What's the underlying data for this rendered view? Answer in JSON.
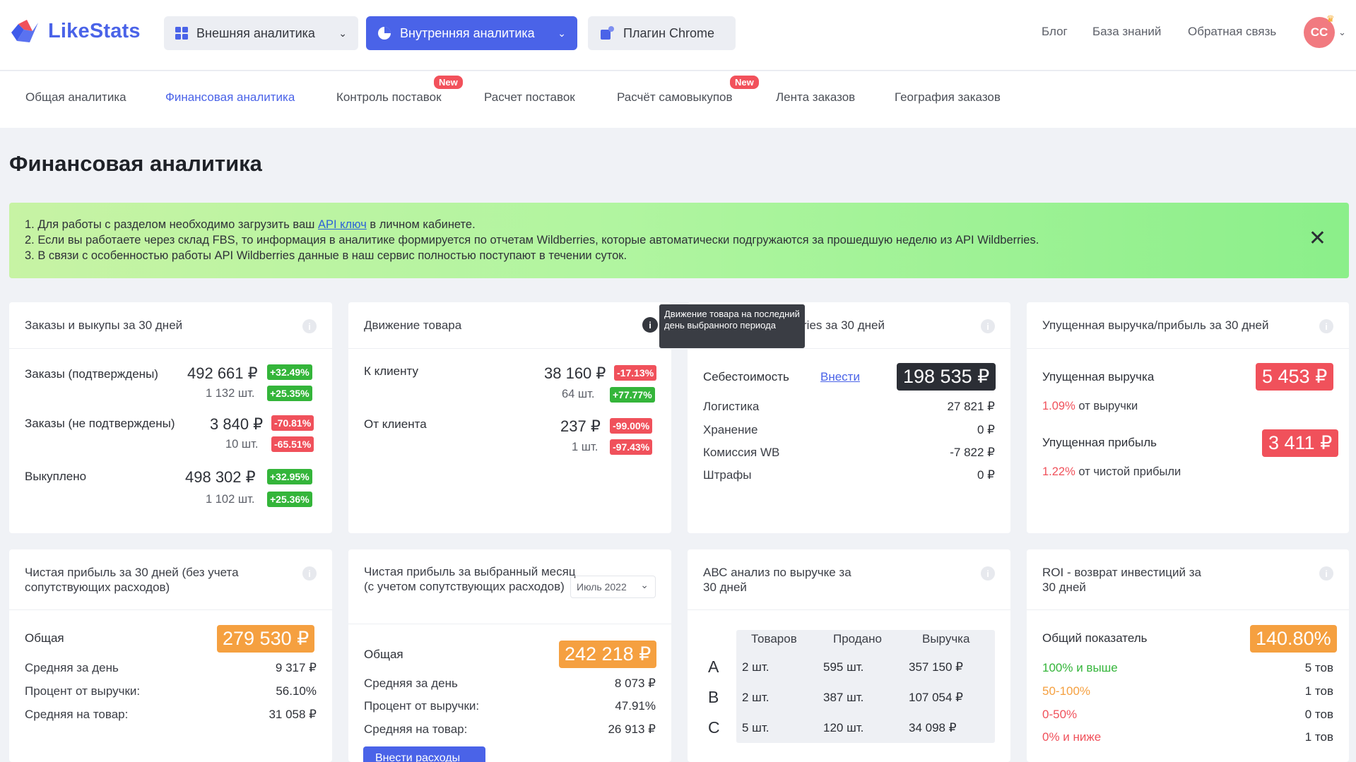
{
  "header": {
    "logo_text": "LikeStats",
    "nav_external": "Внешняя аналитика",
    "nav_internal": "Внутренняя аналитика",
    "nav_plugin": "Плагин Chrome",
    "links": [
      "Блог",
      "База знаний",
      "Обратная связь"
    ],
    "avatar_initials": "CC"
  },
  "tabs": [
    {
      "label": "Общая аналитика"
    },
    {
      "label": "Финансовая аналитика",
      "active": true
    },
    {
      "label": "Контроль поставок",
      "badge": "New"
    },
    {
      "label": "Расчет поставок"
    },
    {
      "label": "Расчёт самовыкупов",
      "badge": "New"
    },
    {
      "label": "Лента заказов"
    },
    {
      "label": "География заказов"
    }
  ],
  "page_title": "Финансовая аналитика",
  "banner": {
    "line1_before": "1. Для работы с разделом необходимо загрузить ваш ",
    "line1_link": "API ключ",
    "line1_after": " в личном кабинете.",
    "line2": "2. Если вы работаете через склад FBS, то информация в аналитике формируется по отчетам Wildberries, которые автоматически подгружаются за прошедшую неделю из API Wildberries.",
    "line3": "3. В связи с особенностью работы API Wildberries данные в наш сервис полностью поступают в течении суток."
  },
  "orders_card": {
    "title": "Заказы и выкупы за 30 дней",
    "confirmed_label": "Заказы (подтверждены)",
    "confirmed_amount": "492 661 ₽",
    "confirmed_amount_change": "+32.49%",
    "confirmed_qty": "1 132 шт.",
    "confirmed_qty_change": "+25.35%",
    "unconfirmed_label": "Заказы (не подтверждены)",
    "unconfirmed_amount": "3 840 ₽",
    "unconfirmed_amount_change": "-70.81%",
    "unconfirmed_qty": "10 шт.",
    "unconfirmed_qty_change": "-65.51%",
    "bought_label": "Выкуплено",
    "bought_amount": "498 302 ₽",
    "bought_amount_change": "+32.95%",
    "bought_qty": "1 102 шт.",
    "bought_qty_change": "+25.36%"
  },
  "movement_card": {
    "title": "Движение товара",
    "to_client_label": "К клиенту",
    "to_client_amount": "38 160 ₽",
    "to_client_amount_change": "-17.13%",
    "to_client_qty": "64 шт.",
    "to_client_qty_change": "+77.77%",
    "from_client_label": "От клиента",
    "from_client_amount": "237 ₽",
    "from_client_amount_change": "-99.00%",
    "from_client_qty": "1 шт.",
    "from_client_qty_change": "-97.43%",
    "tooltip": "Движение товара на последний день выбранного периода"
  },
  "expenses_card": {
    "title_visible": "ries за 30 дней",
    "cost_label": "Себестоимость",
    "cost_link": "Внести",
    "cost_value": "198 535 ₽",
    "rows": [
      {
        "label": "Логистика",
        "value": "27 821 ₽"
      },
      {
        "label": "Хранение",
        "value": "0 ₽"
      },
      {
        "label": "Комиссия WB",
        "value": "-7 822 ₽"
      },
      {
        "label": "Штрафы",
        "value": "0 ₽"
      }
    ]
  },
  "lost_card": {
    "title": "Упущенная выручка/прибыль за 30 дней",
    "revenue_label": "Упущенная выручка",
    "revenue_value": "5 453 ₽",
    "revenue_pct": "1.09%",
    "revenue_pct_text": "от выручки",
    "profit_label": "Упущенная прибыль",
    "profit_value": "3 411 ₽",
    "profit_pct": "1.22%",
    "profit_pct_text": "от чистой прибыли"
  },
  "net_profit_card": {
    "title": "Чистая прибыль за 30 дней (без учета сопутствующих расходов)",
    "total_label": "Общая",
    "total_value": "279 530 ₽",
    "rows": [
      {
        "label": "Средняя за день",
        "value": "9 317 ₽"
      },
      {
        "label": "Процент от выручки:",
        "value": "56.10%"
      },
      {
        "label": "Средняя на товар:",
        "value": "31 058 ₽"
      }
    ]
  },
  "net_month_card": {
    "title": "Чистая прибыль за выбранный месяц (с учетом сопутствующих расходов)",
    "month_select": "Июль 2022",
    "total_label": "Общая",
    "total_value": "242 218 ₽",
    "rows": [
      {
        "label": "Средняя за день",
        "value": "8 073 ₽"
      },
      {
        "label": "Процент от выручки:",
        "value": "47.91%"
      },
      {
        "label": "Средняя на товар:",
        "value": "26 913 ₽"
      }
    ],
    "button": "Внести расходы"
  },
  "abc_card": {
    "title": "АВС анализ по выручке за 30 дней",
    "headers": [
      "Товаров",
      "Продано",
      "Выручка"
    ],
    "rows": [
      {
        "cls": "A",
        "items": "2 шт.",
        "sold": "595 шт.",
        "revenue": "357 150 ₽"
      },
      {
        "cls": "B",
        "items": "2 шт.",
        "sold": "387 шт.",
        "revenue": "107 054 ₽"
      },
      {
        "cls": "C",
        "items": "5 шт.",
        "sold": "120 шт.",
        "revenue": "34 098 ₽"
      }
    ]
  },
  "roi_card": {
    "title": "ROI - возврат инвестиций за 30 дней",
    "total_label": "Общий показатель",
    "total_value": "140.80%",
    "rows": [
      {
        "label": "100% и выше",
        "value": "5 тов",
        "color": "#34b53a"
      },
      {
        "label": "50-100%",
        "value": "1 тов",
        "color": "#f5a040"
      },
      {
        "label": "0-50%",
        "value": "0 тов",
        "color": "#f0515b"
      },
      {
        "label": "0% и ниже",
        "value": "1 тов",
        "color": "#f0515b"
      }
    ]
  },
  "colors": {
    "accent": "#4a63e8",
    "positive": "#34b53a",
    "negative": "#f0515b",
    "orange": "#f5a040"
  }
}
